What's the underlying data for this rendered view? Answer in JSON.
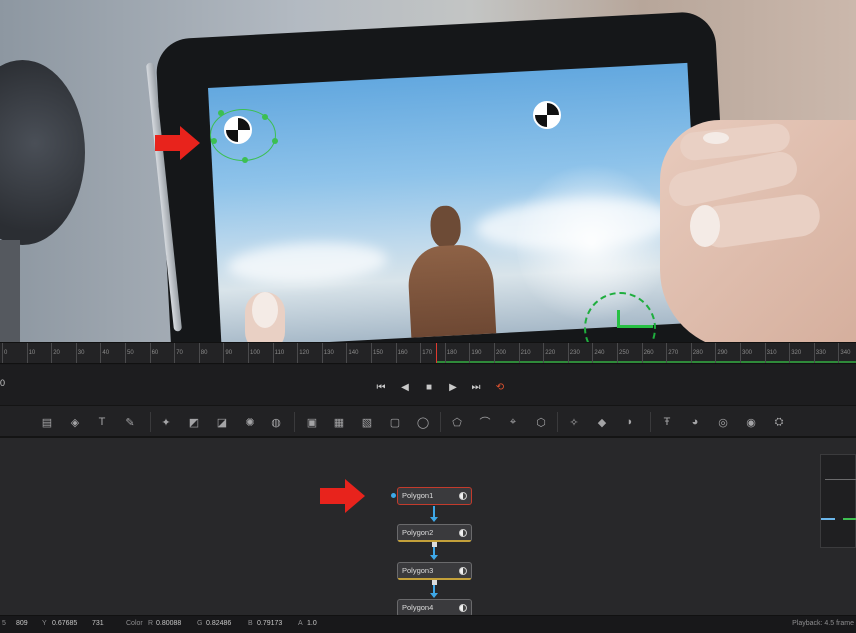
{
  "viewer": {
    "annotation_color": "#e8231c",
    "tracker_color": "#3cbf52"
  },
  "ruler": {
    "labels": [
      "0",
      "10",
      "20",
      "30",
      "40",
      "50",
      "60",
      "70",
      "80",
      "90",
      "100",
      "110",
      "120",
      "130",
      "140",
      "150",
      "160",
      "170",
      "180",
      "190",
      "200",
      "210",
      "220",
      "230",
      "240",
      "250",
      "260",
      "270",
      "280",
      "290",
      "300",
      "310",
      "320",
      "330",
      "340",
      "350",
      "360",
      "370",
      "380"
    ],
    "playhead_color": "#e03a2e"
  },
  "transport": {
    "frame": "0",
    "buttons": {
      "go_start": "⏮",
      "step_back": "◀",
      "stop": "■",
      "play": "▶",
      "go_end": "⏭",
      "loop": "⟲"
    }
  },
  "toolbar": {
    "tools": [
      {
        "icon": "background-icon",
        "glyph": "▤"
      },
      {
        "icon": "paint-icon",
        "glyph": "◈"
      },
      {
        "icon": "text-icon",
        "glyph": "T"
      },
      {
        "icon": "brush-icon",
        "glyph": "✎"
      },
      {
        "icon": "transform-icon",
        "glyph": "✦"
      },
      {
        "icon": "gradient-icon",
        "glyph": "◩"
      },
      {
        "icon": "color-corrector-icon",
        "glyph": "◪"
      },
      {
        "icon": "brightness-icon",
        "glyph": "✺"
      },
      {
        "icon": "blur-icon",
        "glyph": "◍"
      },
      {
        "icon": "merge-icon",
        "glyph": "▣"
      },
      {
        "icon": "matte-icon",
        "glyph": "▦"
      },
      {
        "icon": "channel-icon",
        "glyph": "▧"
      },
      {
        "icon": "rectangle-icon",
        "glyph": "▢"
      },
      {
        "icon": "ellipse-icon",
        "glyph": "◯"
      },
      {
        "icon": "polygon-icon",
        "glyph": "⬠"
      },
      {
        "icon": "bspline-icon",
        "glyph": "⌒"
      },
      {
        "icon": "tracker-icon",
        "glyph": "⌖"
      },
      {
        "icon": "planar-icon",
        "glyph": "⬡"
      },
      {
        "icon": "particles-icon",
        "glyph": "✧"
      },
      {
        "icon": "shape3d-icon",
        "glyph": "◆"
      },
      {
        "icon": "camera3d-icon",
        "glyph": "◗"
      },
      {
        "icon": "text3d-icon",
        "glyph": "Ŧ"
      },
      {
        "icon": "light3d-icon",
        "glyph": "◕"
      },
      {
        "icon": "merge3d-icon",
        "glyph": "◎"
      },
      {
        "icon": "renderer3d-icon",
        "glyph": "◉"
      },
      {
        "icon": "environment-icon",
        "glyph": "⛭"
      }
    ]
  },
  "nodes": [
    {
      "label": "Polygon1",
      "selected": true
    },
    {
      "label": "Polygon2",
      "selected": false
    },
    {
      "label": "Polygon3",
      "selected": false
    },
    {
      "label": "Polygon4",
      "selected": false
    }
  ],
  "status": {
    "x_label": "5",
    "x_val": "809",
    "y_label": "Y",
    "y_val": "0.67685",
    "y_pixel": "731",
    "color_label": "Color",
    "r_label": "R",
    "r_val": "0.80088",
    "g_label": "G",
    "g_val": "0.82486",
    "b_label": "B",
    "b_val": "0.79173",
    "a_label": "A",
    "a_val": "1.0",
    "playback": "Playback: 4.5 frame"
  }
}
